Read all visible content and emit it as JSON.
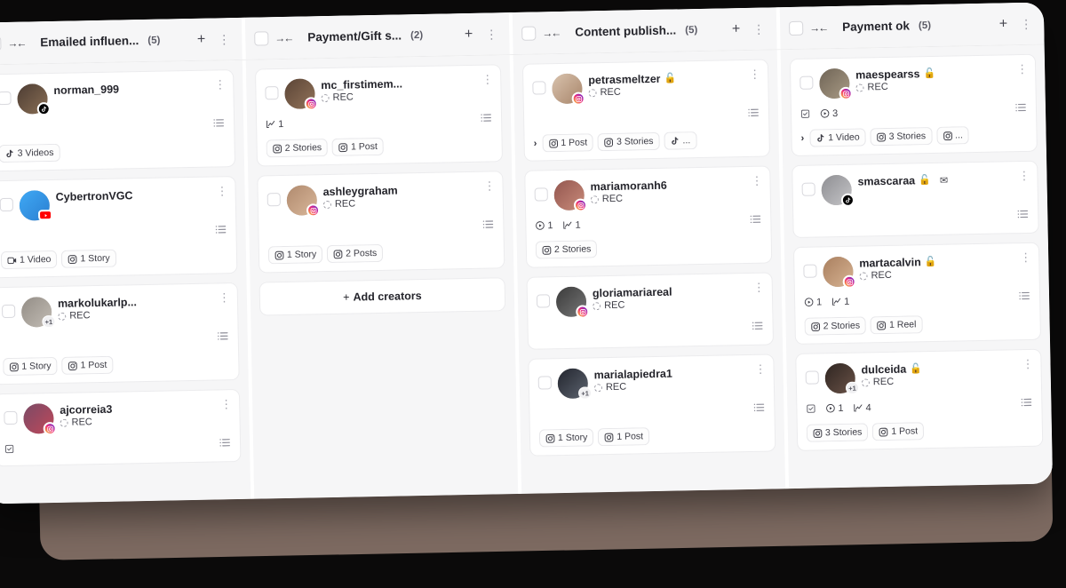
{
  "columns": [
    {
      "title": "Emailed influen...",
      "count": "(5)",
      "add_label": null,
      "cards": [
        {
          "username": "norman_999",
          "platform": "tiktok",
          "avatar_colors": [
            "#4c3c33",
            "#8a6f55"
          ],
          "lock": false,
          "mail": false,
          "extra_count": null,
          "status": null,
          "stats": [],
          "has_chevron": false,
          "pills": [
            {
              "icon": "tiktok-note-icon",
              "label": "3 Videos"
            }
          ]
        },
        {
          "username": "CybertronVGC",
          "platform": "youtube",
          "avatar_colors": [
            "#3fa9f5",
            "#2b7fd1"
          ],
          "lock": false,
          "mail": false,
          "extra_count": null,
          "status": null,
          "stats": [],
          "has_chevron": false,
          "pills": [
            {
              "icon": "video-icon",
              "label": "1 Video"
            },
            {
              "icon": "instagram-icon",
              "label": "1 Story"
            }
          ]
        },
        {
          "username": "markolukarlp...",
          "platform": null,
          "avatar_colors": [
            "#938d86",
            "#c2bcb4"
          ],
          "lock": false,
          "mail": false,
          "extra_count": "+1",
          "status": "REC",
          "stats": [],
          "has_chevron": false,
          "pills": [
            {
              "icon": "instagram-icon",
              "label": "1 Story"
            },
            {
              "icon": "instagram-icon",
              "label": "1 Post"
            }
          ]
        },
        {
          "username": "ajcorreia3",
          "platform": "instagram",
          "avatar_colors": [
            "#7a4a66",
            "#c0485a"
          ],
          "lock": false,
          "mail": false,
          "extra_count": null,
          "status": "REC",
          "stats": [
            {
              "icon": "task-icon",
              "value": ""
            }
          ],
          "has_chevron": false,
          "pills": []
        }
      ]
    },
    {
      "title": "Payment/Gift s...",
      "count": "(2)",
      "add_label": "Add creators",
      "cards": [
        {
          "username": "mc_firstimem...",
          "platform": "instagram",
          "avatar_colors": [
            "#5a4436",
            "#93745a"
          ],
          "lock": false,
          "mail": false,
          "extra_count": null,
          "status": "REC",
          "stats": [
            {
              "icon": "chart-icon",
              "value": "1"
            }
          ],
          "has_chevron": false,
          "pills": [
            {
              "icon": "instagram-icon",
              "label": "2 Stories"
            },
            {
              "icon": "instagram-icon",
              "label": "1 Post"
            }
          ]
        },
        {
          "username": "ashleygraham",
          "platform": "instagram",
          "avatar_colors": [
            "#b08a6e",
            "#d9b79a"
          ],
          "lock": false,
          "mail": false,
          "extra_count": null,
          "status": "REC",
          "stats": [],
          "has_chevron": false,
          "pills": [
            {
              "icon": "instagram-icon",
              "label": "1 Story"
            },
            {
              "icon": "instagram-icon",
              "label": "2 Posts"
            }
          ]
        }
      ]
    },
    {
      "title": "Content publish...",
      "count": "(5)",
      "add_label": null,
      "cards": [
        {
          "username": "petrasmeltzer",
          "platform": "instagram",
          "avatar_colors": [
            "#d9c3ae",
            "#a8856a"
          ],
          "lock": true,
          "mail": false,
          "extra_count": null,
          "status": "REC",
          "stats": [],
          "has_chevron": true,
          "pills": [
            {
              "icon": "instagram-icon",
              "label": "1 Post"
            },
            {
              "icon": "instagram-icon",
              "label": "3 Stories"
            },
            {
              "icon": "tiktok-note-icon",
              "label": "..."
            }
          ]
        },
        {
          "username": "mariamoranh6",
          "platform": "instagram",
          "avatar_colors": [
            "#93564f",
            "#c98b7a"
          ],
          "lock": false,
          "mail": false,
          "extra_count": null,
          "status": "REC",
          "stats": [
            {
              "icon": "play-icon",
              "value": "1"
            },
            {
              "icon": "chart-icon",
              "value": "1"
            }
          ],
          "has_chevron": false,
          "pills": [
            {
              "icon": "instagram-icon",
              "label": "2 Stories"
            }
          ]
        },
        {
          "username": "gloriamariareal",
          "platform": "instagram",
          "avatar_colors": [
            "#3a3a3a",
            "#777777"
          ],
          "lock": false,
          "mail": false,
          "extra_count": null,
          "status": "REC",
          "stats": [],
          "has_chevron": false,
          "pills": []
        },
        {
          "username": "marialapiedra1",
          "platform": null,
          "avatar_colors": [
            "#22252e",
            "#5d646f"
          ],
          "lock": false,
          "mail": false,
          "extra_count": "+1",
          "status": "REC",
          "stats": [],
          "has_chevron": false,
          "pills": [
            {
              "icon": "instagram-icon",
              "label": "1 Story"
            },
            {
              "icon": "instagram-icon",
              "label": "1 Post"
            }
          ]
        }
      ]
    },
    {
      "title": "Payment ok",
      "count": "(5)",
      "add_label": null,
      "cards": [
        {
          "username": "maespearss",
          "platform": "instagram",
          "avatar_colors": [
            "#6f6456",
            "#a99b85"
          ],
          "lock": true,
          "mail": false,
          "extra_count": null,
          "status": "REC",
          "stats": [
            {
              "icon": "task-icon",
              "value": ""
            },
            {
              "icon": "play-icon",
              "value": "3"
            }
          ],
          "has_chevron": true,
          "pills": [
            {
              "icon": "tiktok-note-icon",
              "label": "1 Video"
            },
            {
              "icon": "instagram-icon",
              "label": "3 Stories"
            },
            {
              "icon": "instagram-icon",
              "label": "..."
            }
          ]
        },
        {
          "username": "smascaraa",
          "platform": "tiktok",
          "avatar_colors": [
            "#8e8e92",
            "#c5c5c8"
          ],
          "lock": true,
          "mail": true,
          "extra_count": null,
          "status": null,
          "stats": [],
          "has_chevron": false,
          "pills": []
        },
        {
          "username": "martacalvin",
          "platform": "instagram",
          "avatar_colors": [
            "#a97f5f",
            "#d7b392"
          ],
          "lock": true,
          "mail": false,
          "extra_count": null,
          "status": "REC",
          "stats": [
            {
              "icon": "play-icon",
              "value": "1"
            },
            {
              "icon": "chart-icon",
              "value": "1"
            }
          ],
          "has_chevron": false,
          "pills": [
            {
              "icon": "instagram-icon",
              "label": "2 Stories"
            },
            {
              "icon": "instagram-icon",
              "label": "1 Reel"
            }
          ]
        },
        {
          "username": "dulceida",
          "platform": null,
          "avatar_colors": [
            "#2e2521",
            "#6a5247"
          ],
          "lock": true,
          "mail": false,
          "extra_count": "+1",
          "status": "REC",
          "stats": [
            {
              "icon": "task-icon",
              "value": ""
            },
            {
              "icon": "play-icon",
              "value": "1"
            },
            {
              "icon": "chart-icon",
              "value": "4"
            }
          ],
          "has_chevron": false,
          "pills": [
            {
              "icon": "instagram-icon",
              "label": "3 Stories"
            },
            {
              "icon": "instagram-icon",
              "label": "1 Post"
            }
          ]
        }
      ]
    }
  ],
  "icons": {
    "collapse": "→←",
    "plus": "+",
    "dots": "⋮",
    "chevron": "›",
    "lock": "🔓",
    "mail": "✉",
    "add_plus": "+"
  },
  "colors": {
    "board_bg": "#ffffff",
    "column_bg": "#f6f6f7",
    "backdrop": "#7d6a61",
    "page_bg": "#0b0a0a",
    "text": "#24242b",
    "lock_green": "#2ecc40"
  }
}
